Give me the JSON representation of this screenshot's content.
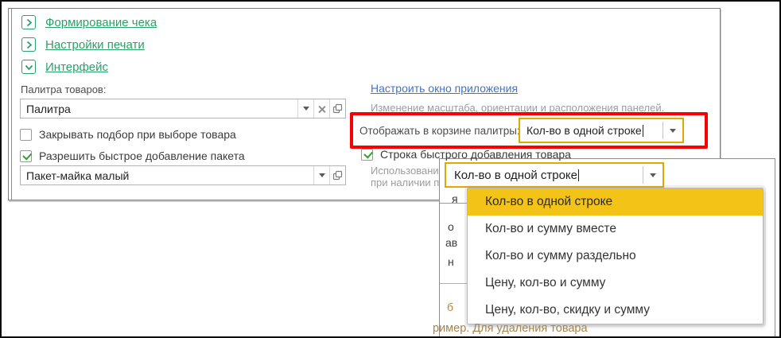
{
  "sections": [
    {
      "label": "Формирование чека",
      "icon": "chevron-right",
      "expanded": false
    },
    {
      "label": "Настройки печати",
      "icon": "chevron-right",
      "expanded": false
    },
    {
      "label": "Интерфейс",
      "icon": "chevron-down",
      "expanded": true
    }
  ],
  "left_panel": {
    "palette_label": "Палитра товаров:",
    "palette_value": "Палитра",
    "checkbox_close_on_select": {
      "label": "Закрывать подбор при выборе товара",
      "checked": false
    },
    "checkbox_quick_package": {
      "label": "Разрешить быстрое добавление пакета",
      "checked": true
    },
    "package_value": "Пакет-майка малый"
  },
  "right_panel": {
    "app_window_link": "Настроить окно приложения",
    "app_window_hint": "Изменение масштаба, ориентации и расположения панелей.",
    "basket_display_label": "Отображать в корзине палитры:",
    "basket_display_value": "Кол-во в одной строке",
    "checkbox_quick_row": {
      "label": "Строка быстрого добавления товара",
      "checked": true
    },
    "usage_line1": "Использование стро",
    "usage_line2": "при наличии подклю"
  },
  "popup": {
    "combo_value": "Кол-во в одной строке",
    "options": [
      {
        "label": "Кол-во в одной строке",
        "selected": true
      },
      {
        "label": "Кол-во и сумму вместе",
        "selected": false
      },
      {
        "label": "Кол-во и сумму раздельно",
        "selected": false
      },
      {
        "label": "Цену, кол-во и сумму",
        "selected": false
      },
      {
        "label": "Цену, кол-во, скидку и сумму",
        "selected": false
      }
    ],
    "fragments": {
      "f1": "я",
      "f2": "о",
      "f3": "ав",
      "f4": "н",
      "f5": "б"
    },
    "bottom_text": "ример.   Для удаления товара"
  },
  "colors": {
    "accent_green": "#2aa06a",
    "check_green": "#2fa12c",
    "link_blue": "#4273c8",
    "highlight_red": "#fb0000",
    "focus_yellow_border": "#e0a800",
    "selected_item_yellow": "#f3c318",
    "muted_text": "#9d9d9d"
  }
}
